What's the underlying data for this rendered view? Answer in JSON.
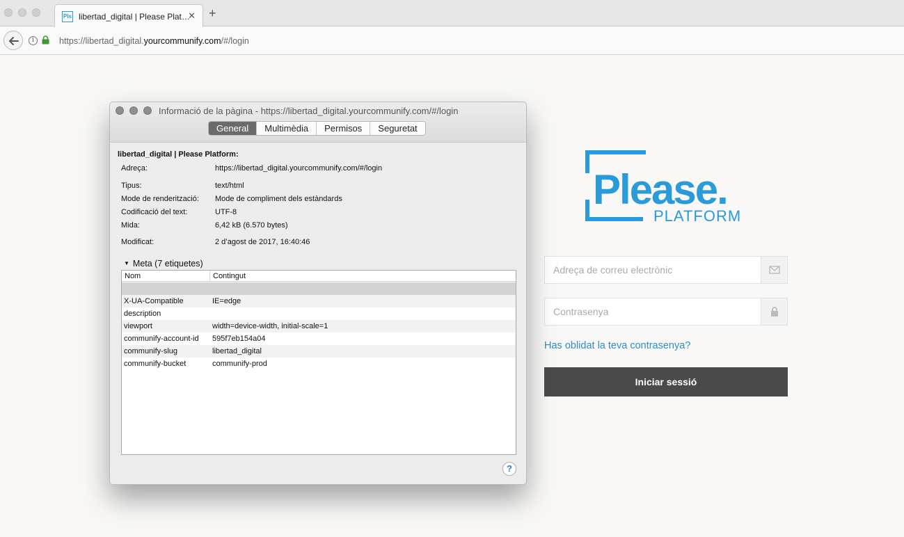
{
  "browser": {
    "tab_title": "libertad_digital | Please Plat…",
    "tab_favicon_text": "Pls",
    "tab_close": "✕",
    "new_tab": "+",
    "url_prefix": "https://libertad_digital.",
    "url_domain": "yourcommunify.com",
    "url_suffix": "/#/login"
  },
  "login": {
    "email_placeholder": "Adreça de correu electrònic",
    "password_placeholder": "Contrasenya",
    "forgot_link": "Has oblidat la teva contrasenya?",
    "submit_label": "Iniciar sessió",
    "logo_text": "Please.",
    "logo_subtext": "PLATFORM",
    "brand_color": "#2a9bd8"
  },
  "dialog": {
    "title": "Informació de la pàgina - https://libertad_digital.yourcommunify.com/#/login",
    "tabs": [
      "General",
      "Multimèdia",
      "Permisos",
      "Seguretat"
    ],
    "active_tab": "General",
    "page_name": "libertad_digital | Please Platform:",
    "fields": [
      {
        "label": "Adreça:",
        "value": "https://libertad_digital.yourcommunify.com/#/login"
      },
      {
        "label": "Tipus:",
        "value": "text/html"
      },
      {
        "label": "Mode de renderització:",
        "value": "Mode de compliment dels estàndards"
      },
      {
        "label": "Codificació del text:",
        "value": "UTF-8"
      },
      {
        "label": "Mida:",
        "value": "6,42 kB (6.570 bytes)"
      },
      {
        "label": "Modificat:",
        "value": "2 d’agost de 2017, 16:40:46"
      }
    ],
    "meta_toggle": "Meta (7 etiquetes)",
    "meta_columns": [
      "Nom",
      "Contingut"
    ],
    "meta_rows": [
      {
        "name": "",
        "content": ""
      },
      {
        "name": "X-UA-Compatible",
        "content": "IE=edge"
      },
      {
        "name": "description",
        "content": ""
      },
      {
        "name": "viewport",
        "content": "width=device-width, initial-scale=1"
      },
      {
        "name": "communify-account-id",
        "content": "595f7eb154a04"
      },
      {
        "name": "communify-slug",
        "content": "libertad_digital"
      },
      {
        "name": "communify-bucket",
        "content": "communify-prod"
      }
    ],
    "help": "?"
  }
}
